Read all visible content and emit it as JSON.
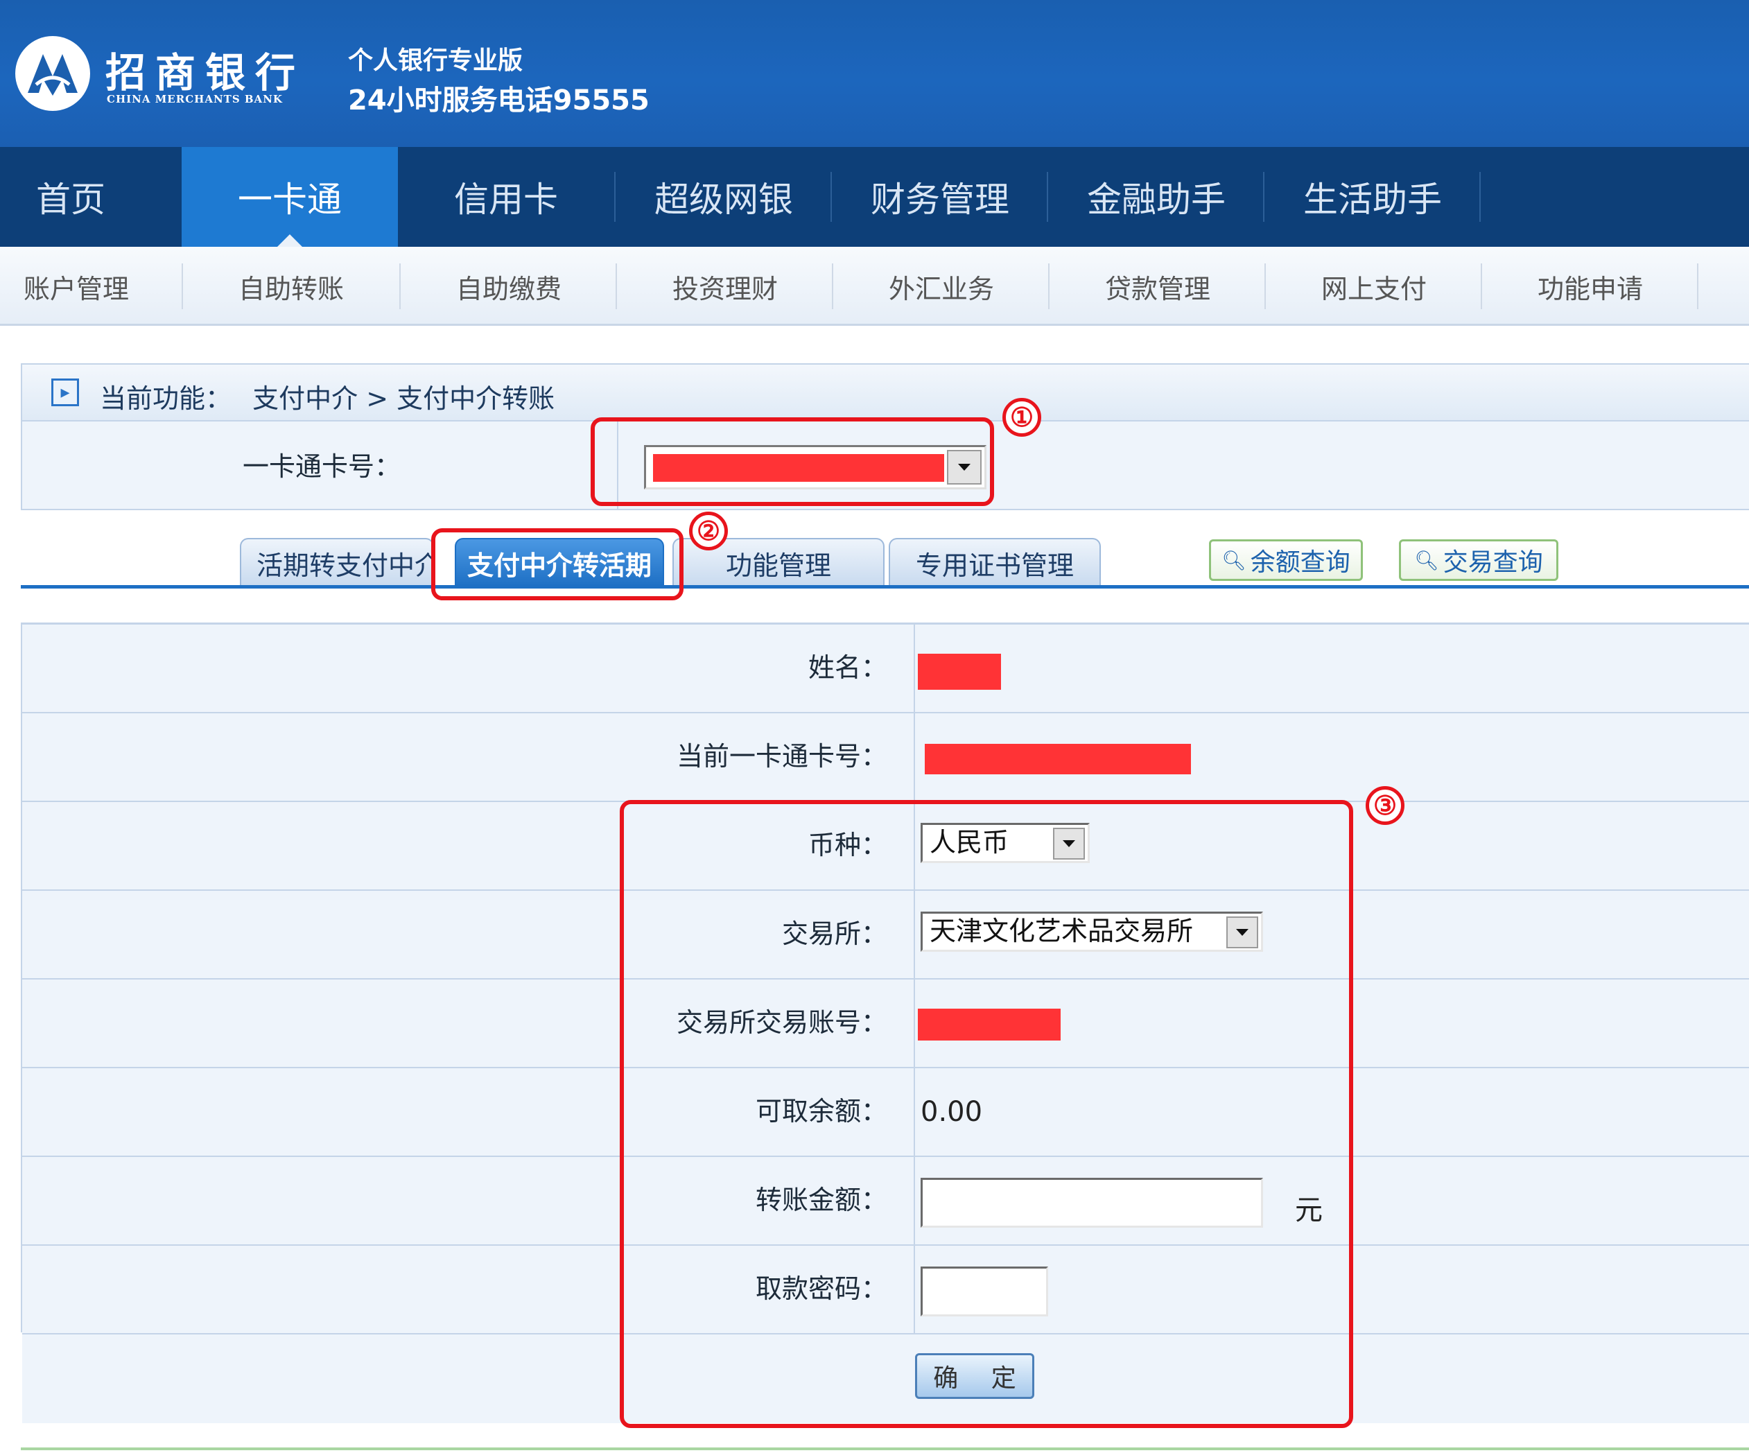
{
  "header": {
    "bank_name": "招商银行",
    "bank_name_en": "CHINA MERCHANTS BANK",
    "edition": "个人银行专业版",
    "hotline": "24小时服务电话95555"
  },
  "main_nav": [
    "首页",
    "一卡通",
    "信用卡",
    "超级网银",
    "财务管理",
    "金融助手",
    "生活助手"
  ],
  "main_nav_active": "一卡通",
  "sub_nav": [
    "账户管理",
    "自助转账",
    "自助缴费",
    "投资理财",
    "外汇业务",
    "贷款管理",
    "网上支付",
    "功能申请"
  ],
  "breadcrumb": {
    "prefix": "当前功能：",
    "path": "支付中介 > 支付中介转账"
  },
  "card_selector": {
    "label": "一卡通卡号："
  },
  "tabs": [
    "活期转支付中介",
    "支付中介转活期",
    "功能管理",
    "专用证书管理"
  ],
  "tab_active": "支付中介转活期",
  "query_buttons": [
    "余额查询",
    "交易查询"
  ],
  "form": {
    "name_label": "姓名：",
    "card_label": "当前一卡通卡号：",
    "currency_label": "币种：",
    "currency_value": "人民币",
    "exchange_label": "交易所：",
    "exchange_value": "天津文化艺术品交易所",
    "exchange_account_label": "交易所交易账号：",
    "balance_label": "可取余额：",
    "balance_value": "0.00 元",
    "amount_label": "转账金额：",
    "amount_value": "",
    "amount_unit": "元",
    "password_label": "取款密码：",
    "password_value": "",
    "submit_label": "确 定"
  },
  "annotations": [
    "①",
    "②",
    "③"
  ],
  "colors": {
    "brand_blue": "#1c66bd",
    "nav_dark": "#0d3f78",
    "nav_active": "#1e7ad2",
    "annotation_red": "#e8141c",
    "redaction_red": "#ff3336"
  }
}
